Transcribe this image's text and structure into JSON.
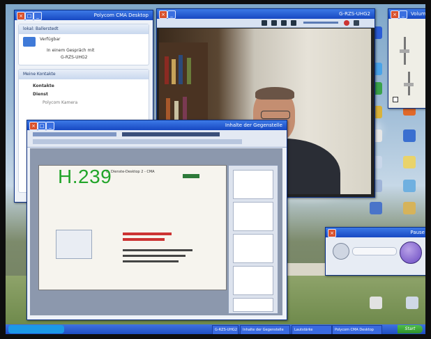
{
  "overlay_label": "H.239",
  "windows": {
    "contacts": {
      "title": "Polycom CMA Desktop",
      "local_header": "lokal: Ballerstedt",
      "local_status": "Verfügbar",
      "local_line": "In einem Gespräch mit",
      "local_device": "G-RZS-UHG2",
      "contacts_header": "Meine Kontakte",
      "section_contacts": "Kontakte",
      "section_group": "Dienst",
      "contact_1": "Polycom Kamera"
    },
    "video": {
      "title": "G-RZS-UHG2"
    },
    "volume": {
      "title": "Volume"
    },
    "presentation": {
      "title": "Inhalte der Gegenstelle",
      "slide_heading": "G. Dienste-Desktop 2 - CMA",
      "slide_side_text": "Polycom CMA Desktop"
    },
    "pause": {
      "title": "Pause"
    }
  },
  "taskbar": {
    "start_label": "Start",
    "items": [
      "Inhalte der Gegenstelle",
      "G-RZS-UHG2",
      "Polycom CMA Desktop",
      "Lautstärke"
    ]
  },
  "colors": {
    "titlebar": "#1748c2",
    "overlay_green": "#22a52a",
    "taskbar": "#1f4ec2"
  }
}
